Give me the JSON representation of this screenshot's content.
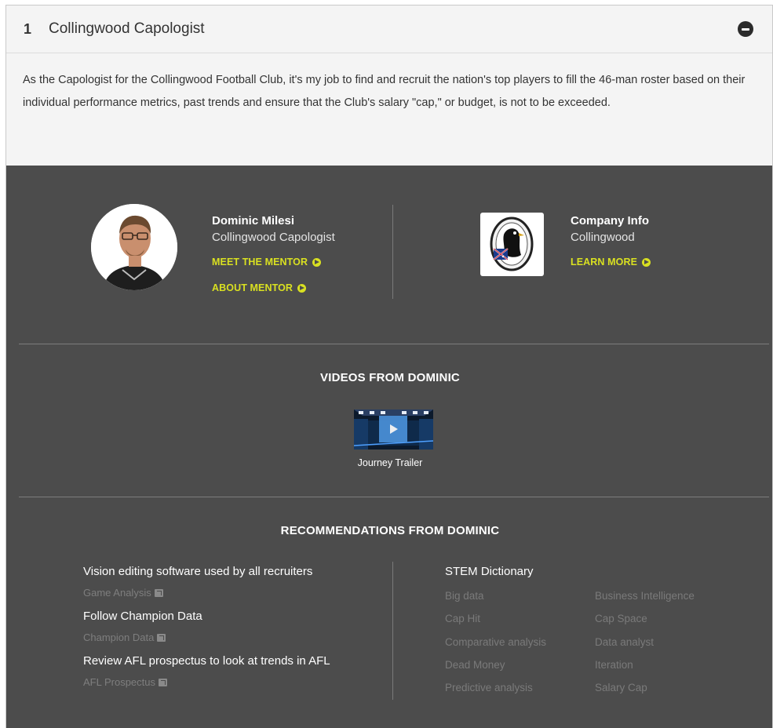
{
  "section": {
    "number": "1",
    "title": "Collingwood Capologist",
    "description": "As the Capologist for the Collingwood Football Club, it's my job to find and recruit the nation's top players to fill the 46-man roster based on their individual performance metrics, past trends and ensure that the Club's salary \"cap,\" or budget, is not to be exceeded."
  },
  "mentor": {
    "name": "Dominic Milesi",
    "role": "Collingwood Capologist",
    "meet_label": "MEET THE MENTOR",
    "about_label": "ABOUT MENTOR"
  },
  "company": {
    "label": "Company Info",
    "name": "Collingwood",
    "learn_label": "LEARN MORE"
  },
  "videos": {
    "title": "VIDEOS FROM DOMINIC",
    "items": [
      {
        "caption": "Journey Trailer"
      }
    ]
  },
  "recommendations": {
    "title": "RECOMMENDATIONS FROM DOMINIC",
    "items": [
      {
        "title": "Vision editing software used by all recruiters",
        "link": "Game Analysis"
      },
      {
        "title": "Follow Champion Data",
        "link": "Champion Data"
      },
      {
        "title": "Review AFL prospectus to look at trends in AFL",
        "link": "AFL Prospectus"
      }
    ],
    "dictionary": {
      "title": "STEM Dictionary",
      "terms": [
        "Big data",
        "Business Intelligence",
        "Cap Hit",
        "Cap Space",
        "Comparative analysis",
        "Data analyst",
        "Dead Money",
        "Iteration",
        "Predictive analysis",
        "Salary Cap"
      ]
    }
  },
  "colors": {
    "accent": "#d9e021",
    "panel": "#4c4c4c",
    "muted_link": "#7e7e7e"
  },
  "icons": {
    "collapse": "minus-circle-icon",
    "arrow": "arrow-circle-right-icon",
    "external": "external-link-icon",
    "play": "play-icon"
  }
}
